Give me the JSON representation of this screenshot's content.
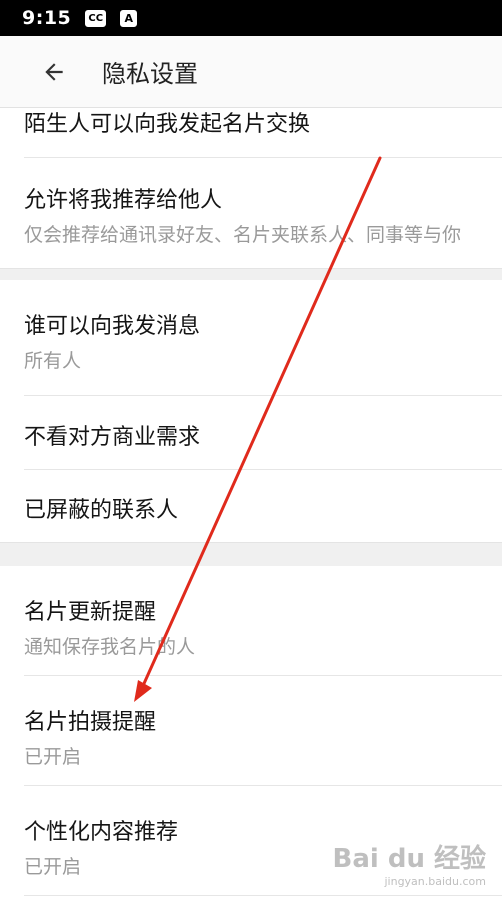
{
  "status_bar": {
    "time": "9:15",
    "icons": [
      "cc-icon",
      "font-a-icon"
    ]
  },
  "header": {
    "title": "隐私设置",
    "back_icon": "arrow-left-icon"
  },
  "items": [
    {
      "title": "陌生人可以向我发起名片交换"
    },
    {
      "title": "允许将我推荐给他人",
      "subtitle": "仅会推荐给通讯录好友、名片夹联系人、同事等与你"
    },
    {
      "title": "谁可以向我发消息",
      "subtitle": "所有人"
    },
    {
      "title": "不看对方商业需求"
    },
    {
      "title": "已屏蔽的联系人"
    },
    {
      "title": "名片更新提醒",
      "subtitle": "通知保存我名片的人"
    },
    {
      "title": "名片拍摄提醒",
      "subtitle": "已开启"
    },
    {
      "title": "个性化内容推荐",
      "subtitle": "已开启"
    }
  ],
  "annotation": {
    "color": "#e02a1c"
  },
  "watermark": {
    "brand": "Bai du 经验",
    "url": "jingyan.baidu.com"
  }
}
